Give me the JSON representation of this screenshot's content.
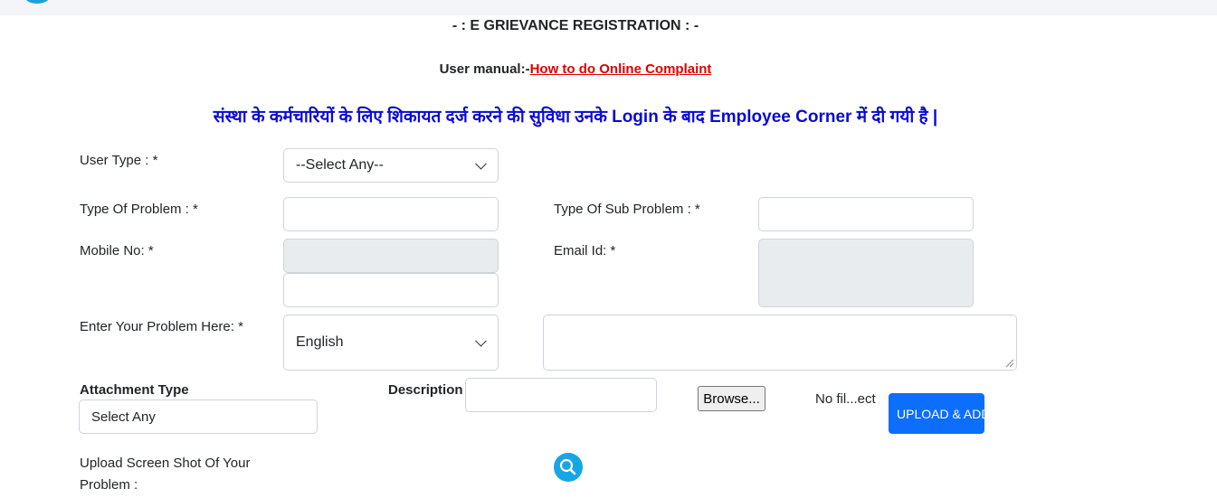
{
  "header": {
    "title": "- : E GRIEVANCE REGISTRATION : -",
    "manual_prefix": "User manual:-",
    "manual_link": "How to do Online Complaint",
    "notice": "संस्था के कर्मचारियों के लिए शिकायत दर्ज करने की सुविधा उनके Login के बाद Employee Corner में दी गयी है |"
  },
  "form": {
    "user_type_label": "User Type : *",
    "user_type_value": "--Select Any--",
    "problem_type_label": "Type Of Problem : *",
    "sub_problem_label": "Type Of Sub Problem : *",
    "mobile_label": "Mobile No: *",
    "email_label": "Email Id: *",
    "problem_label": "Enter Your Problem Here: *",
    "language_value": "English",
    "attachment_type_label": "Attachment Type",
    "attachment_type_value": "Select Any",
    "description_label": "Description",
    "browse_label": "Browse...",
    "file_status": "No fil...ect",
    "upload_label": "UPLOAD & ADD",
    "screenshot_label_line1": "Upload Screen Shot Of Your",
    "screenshot_label_line2": "Problem :"
  },
  "icons": {
    "search": "search-icon",
    "dropdown": "chevron-down-icon"
  },
  "colors": {
    "notice": "#0a0ad1",
    "link": "#e00000",
    "upload_button": "#0d6efd",
    "search_button": "#16a5e6",
    "disabled_field": "#e9ecef"
  }
}
